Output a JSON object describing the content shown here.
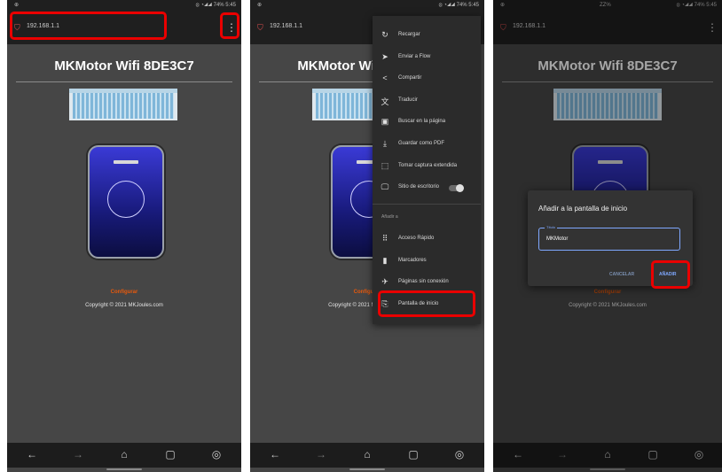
{
  "status_bar": {
    "left": "⊕",
    "right": "⦻ ◔◢◢ 74% 5:45",
    "mid": "ZZ%"
  },
  "browser": {
    "url": "192.168.1.1",
    "url_panel3": "192.168.1.1"
  },
  "page": {
    "title": "MKMotor Wifi 8DE3C7",
    "config_link": "Configurar",
    "copyright": "Copyright © 2021 MKJoules.com"
  },
  "menu": {
    "items": [
      {
        "label": "Recargar",
        "icon": "reload-icon"
      },
      {
        "label": "Enviar a Flow",
        "icon": "send-icon"
      },
      {
        "label": "Compartir",
        "icon": "share-icon"
      },
      {
        "label": "Traducir",
        "icon": "translate-icon"
      },
      {
        "label": "Buscar en la página",
        "icon": "find-in-page-icon"
      },
      {
        "label": "Guardar como PDF",
        "icon": "download-icon"
      },
      {
        "label": "Tomar captura extendida",
        "icon": "screenshot-icon"
      },
      {
        "label": "Sitio de escritorio",
        "icon": "desktop-icon"
      }
    ],
    "section_title": "Añadir a",
    "items2": [
      {
        "label": "Acceso Rápido",
        "icon": "grid-icon"
      },
      {
        "label": "Marcadores",
        "icon": "bookmark-icon"
      },
      {
        "label": "Páginas sin conexión",
        "icon": "airplane-icon"
      },
      {
        "label": "Pantalla de inicio",
        "icon": "add-to-home-icon"
      }
    ]
  },
  "dialog": {
    "title": "Añadir a la pantalla de inicio",
    "input_label": "Título",
    "input_value": "MKMotor",
    "cancel": "CANCELAR",
    "add": "AÑADIR"
  },
  "nav": [
    "←",
    "→",
    "⌂",
    "▢",
    "◎"
  ],
  "colors": {
    "highlight": "#ea0000",
    "accent": "#7fa8ff",
    "link": "#e8590c"
  }
}
